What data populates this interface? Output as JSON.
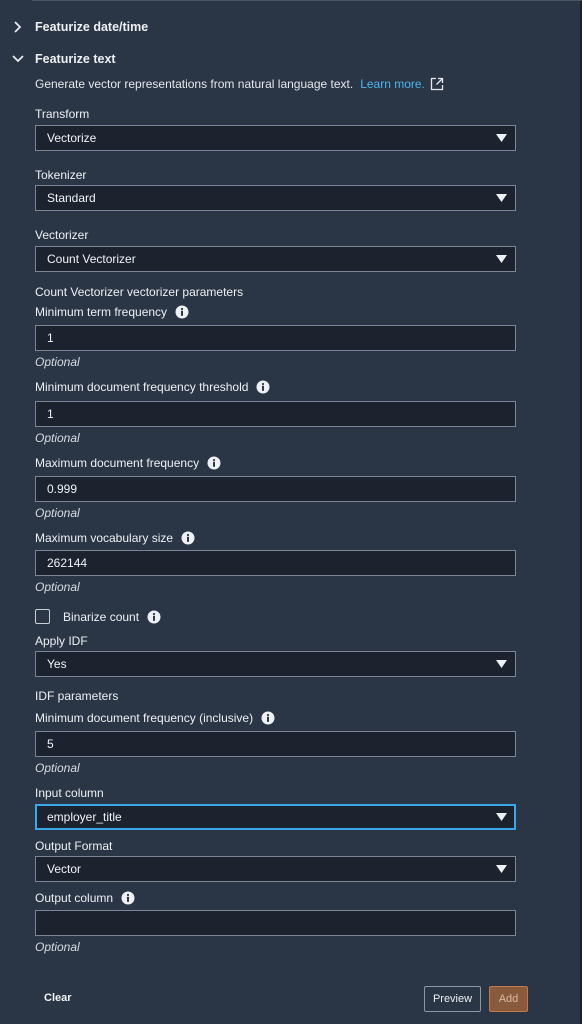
{
  "sections": {
    "featurize_datetime": "Featurize date/time",
    "featurize_text": "Featurize text"
  },
  "description": {
    "text": "Generate vector representations from natural language text.",
    "link": "Learn more."
  },
  "transform": {
    "label": "Transform",
    "value": "Vectorize"
  },
  "tokenizer": {
    "label": "Tokenizer",
    "value": "Standard"
  },
  "vectorizer": {
    "label": "Vectorizer",
    "value": "Count Vectorizer"
  },
  "vectorizer_params_heading": "Count Vectorizer vectorizer parameters",
  "min_term_freq": {
    "label": "Minimum term frequency",
    "value": "1",
    "hint": "Optional"
  },
  "min_doc_freq_threshold": {
    "label": "Minimum document frequency threshold",
    "value": "1",
    "hint": "Optional"
  },
  "max_doc_freq": {
    "label": "Maximum document frequency",
    "value": "0.999",
    "hint": "Optional"
  },
  "max_vocab_size": {
    "label": "Maximum vocabulary size",
    "value": "262144",
    "hint": "Optional"
  },
  "binarize": {
    "label": "Binarize count",
    "checked": false
  },
  "apply_idf": {
    "label": "Apply IDF",
    "value": "Yes"
  },
  "idf_params_heading": "IDF parameters",
  "min_doc_freq_inclusive": {
    "label": "Minimum document frequency (inclusive)",
    "value": "5",
    "hint": "Optional"
  },
  "input_column": {
    "label": "Input column",
    "value": "employer_title"
  },
  "output_format": {
    "label": "Output Format",
    "value": "Vector"
  },
  "output_column": {
    "label": "Output column",
    "value": "",
    "hint": "Optional"
  },
  "buttons": {
    "clear": "Clear",
    "preview": "Preview",
    "add": "Add"
  },
  "colors": {
    "background": "#2a3545",
    "field_bg": "#1c232f",
    "link": "#4ab7ee",
    "focus": "#3aa7e6",
    "add_button": "#8a5a3d"
  }
}
